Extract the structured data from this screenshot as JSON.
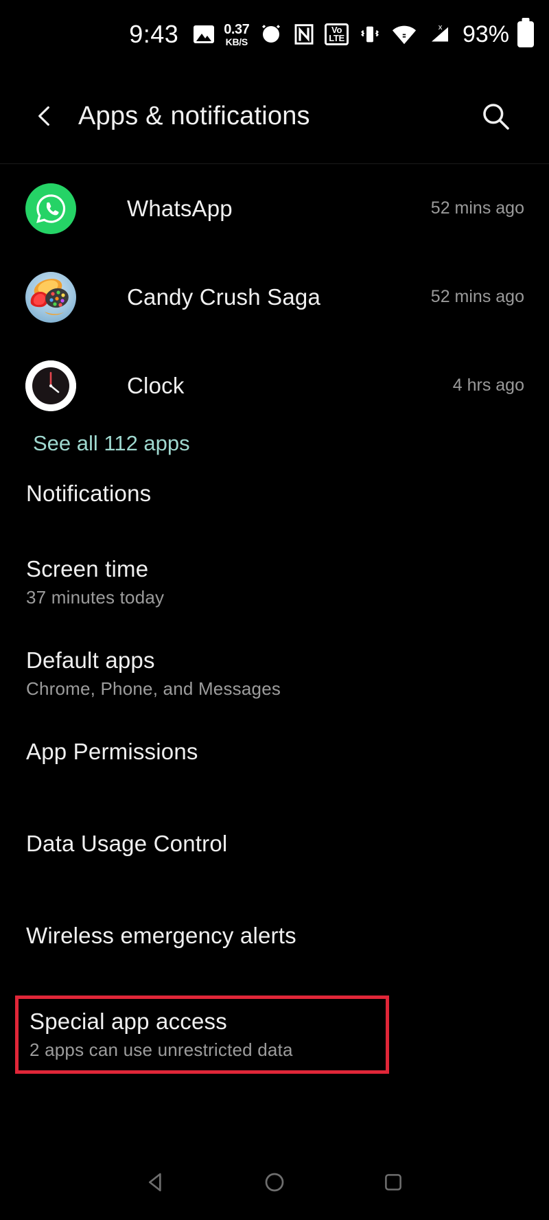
{
  "status_bar": {
    "time": "9:43",
    "network_speed_value": "0.37",
    "network_speed_unit": "KB/S",
    "volte_top": "Vo",
    "volte_bottom": "LTE",
    "battery_percent": "93%",
    "icons": [
      "photo-icon",
      "network-speed-icon",
      "alarm-icon",
      "nfc-icon",
      "volte-icon",
      "vibrate-icon",
      "wifi-icon",
      "signal-icon",
      "battery-icon"
    ]
  },
  "header": {
    "title": "Apps & notifications",
    "back_icon": "chevron-left-icon",
    "search_icon": "search-icon"
  },
  "recent_apps": [
    {
      "name": "WhatsApp",
      "time": "52 mins ago",
      "icon": "whatsapp-icon"
    },
    {
      "name": "Candy Crush Saga",
      "time": "52 mins ago",
      "icon": "candy-crush-icon"
    },
    {
      "name": "Clock",
      "time": "4 hrs ago",
      "icon": "clock-icon"
    }
  ],
  "see_all": {
    "label": "See all 112 apps",
    "color": "#9fd8cf"
  },
  "settings_items": {
    "notifications": {
      "title": "Notifications",
      "subtitle": ""
    },
    "screen_time": {
      "title": "Screen time",
      "subtitle": "37 minutes today"
    },
    "default_apps": {
      "title": "Default apps",
      "subtitle": "Chrome, Phone, and Messages"
    },
    "app_permissions": {
      "title": "App Permissions",
      "subtitle": ""
    },
    "data_usage": {
      "title": "Data Usage Control",
      "subtitle": ""
    },
    "emergency_alerts": {
      "title": "Wireless emergency alerts",
      "subtitle": ""
    },
    "special_access": {
      "title": "Special app access",
      "subtitle": "2 apps can use unrestricted data"
    }
  },
  "highlight": {
    "target": "special_access",
    "color": "#e02638"
  },
  "nav_bar": {
    "back": "nav-back-icon",
    "home": "nav-home-icon",
    "recents": "nav-recents-icon"
  }
}
